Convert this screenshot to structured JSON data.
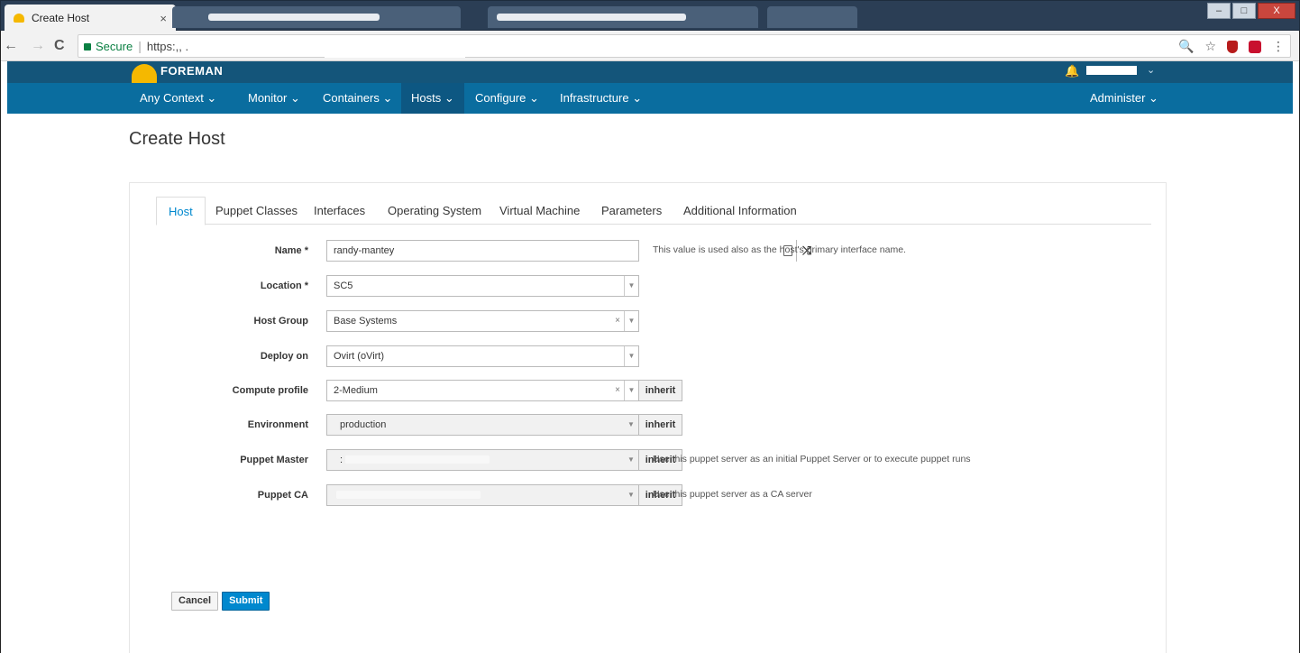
{
  "browser": {
    "tab_title": "Create Host",
    "tab_close": "×",
    "secure_label": "Secure",
    "url_separator": "|",
    "url_text": "https:,, .",
    "nav_back": "←",
    "nav_forward": "→",
    "nav_reload": "C",
    "zoom_icon": "🔍",
    "star_icon": "☆",
    "menu_icon": "⋮",
    "win_min": "–",
    "win_max": "□",
    "win_close": "X"
  },
  "header": {
    "brand": "FOREMAN",
    "bell": "🔔",
    "user_chevron": "⌄"
  },
  "menu": {
    "items": [
      {
        "label": "Any Context ⌄",
        "active": false
      },
      {
        "label": "Monitor ⌄",
        "active": false
      },
      {
        "label": "Containers ⌄",
        "active": false
      },
      {
        "label": "Hosts ⌄",
        "active": true
      },
      {
        "label": "Configure ⌄",
        "active": false
      },
      {
        "label": "Infrastructure ⌄",
        "active": false
      }
    ],
    "administer": "Administer ⌄"
  },
  "page": {
    "title": "Create Host"
  },
  "tabs": [
    {
      "label": "Host",
      "active": true
    },
    {
      "label": "Puppet Classes",
      "active": false
    },
    {
      "label": "Interfaces",
      "active": false
    },
    {
      "label": "Operating System",
      "active": false
    },
    {
      "label": "Virtual Machine",
      "active": false
    },
    {
      "label": "Parameters",
      "active": false
    },
    {
      "label": "Additional Information",
      "active": false
    }
  ],
  "form": {
    "name": {
      "label": "Name *",
      "value": "randy-mantey",
      "help": "This value is used also as the host's primary interface name."
    },
    "location": {
      "label": "Location *",
      "value": "SC5"
    },
    "host_group": {
      "label": "Host Group",
      "value": "Base Systems"
    },
    "deploy_on": {
      "label": "Deploy on",
      "value": "Ovirt (oVirt)"
    },
    "compute_profile": {
      "label": "Compute profile",
      "value": "2-Medium",
      "inherit": "inherit"
    },
    "environment": {
      "label": "Environment",
      "value": "production",
      "inherit": "inherit"
    },
    "puppet_master": {
      "label": "Puppet Master",
      "value": ":",
      "inherit": "inherit",
      "help": "Use this puppet server as an initial Puppet Server or to execute puppet runs"
    },
    "puppet_ca": {
      "label": "Puppet CA",
      "value": "",
      "inherit": "inherit",
      "help": "Use this puppet server as a CA server"
    }
  },
  "actions": {
    "cancel": "Cancel",
    "submit": "Submit"
  },
  "glyphs": {
    "clear": "×",
    "arrow": "▼"
  }
}
